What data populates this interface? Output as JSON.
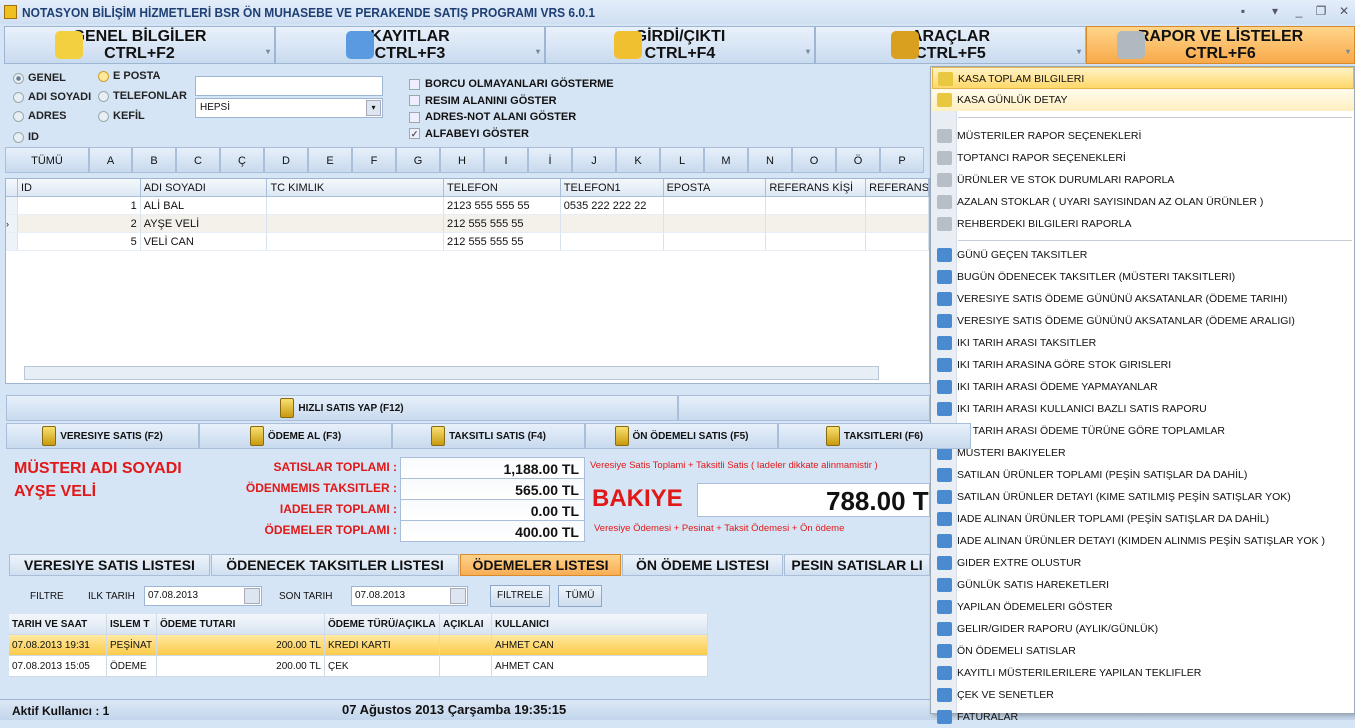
{
  "window": {
    "title": "NOTASYON BİLİŞİM HİZMETLERİ BSR ÖN MUHASEBE VE PERAKENDE SATIŞ PROGRAMI VRS 6.0.1",
    "controls": [
      "▪",
      "▾",
      "_",
      "❐",
      "✕"
    ]
  },
  "top_menu": [
    {
      "label": "GENEL BİLGİLER",
      "shortcut": "CTRL+F2",
      "icon": "monitor-icon",
      "color": "#f3d040"
    },
    {
      "label": "KAYITLAR",
      "shortcut": "CTRL+F3",
      "icon": "users-icon",
      "color": "#5a9ae0"
    },
    {
      "label": "GİRDİ/ÇIKTI",
      "shortcut": "CTRL+F4",
      "icon": "arrows-icon",
      "color": "#f0c030"
    },
    {
      "label": "ARAÇLAR",
      "shortcut": "CTRL+F5",
      "icon": "truck-icon",
      "color": "#d9a020"
    },
    {
      "label": "RAPOR VE LİSTELER",
      "shortcut": "CTRL+F6",
      "icon": "printer-icon",
      "color": "#b0b8c0"
    }
  ],
  "search": {
    "radios": [
      "GENEL",
      "ADI SOYADI",
      "ADRES",
      "ID",
      "E POSTA",
      "TELEFONLAR",
      "KEFİL"
    ],
    "text": "",
    "combo": "HEPSİ",
    "checks": [
      {
        "label": "BORCU OLMAYANLARI GÖSTERME",
        "checked": false
      },
      {
        "label": "RESIM ALANINI GÖSTER",
        "checked": false
      },
      {
        "label": "ADRES-NOT ALANI GÖSTER",
        "checked": false
      },
      {
        "label": "ALFABEYI GÖSTER",
        "checked": true
      }
    ]
  },
  "alphabet": [
    "TÜMÜ",
    "A",
    "B",
    "C",
    "Ç",
    "D",
    "E",
    "F",
    "G",
    "H",
    "I",
    "İ",
    "J",
    "K",
    "L",
    "M",
    "N",
    "O",
    "Ö",
    "P"
  ],
  "grid": {
    "columns": [
      "ID",
      "ADI SOYADI",
      "TC KIMLIK",
      "TELEFON",
      "TELEFON1",
      "EPOSTA",
      "REFERANS KİŞİ",
      "REFERANS"
    ],
    "rows": [
      [
        "1",
        "ALİ BAL",
        "",
        "2123 555 555 55",
        "0535 222 222 22",
        "",
        "",
        ""
      ],
      [
        "2",
        "AYŞE VELİ",
        "",
        "212 555 555 55",
        "",
        "",
        "",
        ""
      ],
      [
        "5",
        "VELİ CAN",
        "",
        "212 555 555 55",
        "",
        "",
        "",
        ""
      ]
    ]
  },
  "actions": {
    "quick": "HIZLI SATIS YAP  (F12)",
    "buttons": [
      "VERESIYE SATIS  (F2)",
      "ÖDEME AL (F3)",
      "TAKSITLI SATIS  (F4)",
      "ÖN ÖDEMELI SATIS   (F5)",
      "TAKSITLERI  (F6)"
    ]
  },
  "summary": {
    "customer_label": "MÜSTERI ADI SOYADI",
    "customer_name": "AYŞE VELİ",
    "rows": [
      {
        "label": "SATISLAR TOPLAMI :",
        "value": "1,188.00 TL"
      },
      {
        "label": "ÖDENMEMIS TAKSITLER :",
        "value": "565.00 TL"
      },
      {
        "label": "IADELER TOPLAMI :",
        "value": "0.00 TL"
      },
      {
        "label": "ÖDEMELER TOPLAMI :",
        "value": "400.00 TL"
      }
    ],
    "note1": "Veresiye Satis Toplami + Taksitli Satis ( Iadeler dikkate alinmamistir )",
    "note2": "Veresiye Ödemesi + Pesinat + Taksit Ödemesi + Ön ödeme",
    "balance_label": "BAKIYE",
    "balance_value": "788.00 TL"
  },
  "tabs": [
    "VERESIYE SATIS LISTESI",
    "ÖDENECEK TAKSITLER LISTESI",
    "ÖDEMELER LISTESI",
    "ÖN ÖDEME LISTESI",
    "PESIN SATISLAR LI"
  ],
  "filter": {
    "label": "FILTRE",
    "start_label": "ILK TARIH",
    "start": "07.08.2013",
    "end_label": "SON TARIH",
    "end": "07.08.2013",
    "filter_btn": "FILTRELE",
    "all_btn": "TÜMÜ"
  },
  "payments": {
    "columns": [
      "TARIH VE SAAT",
      "ISLEM T",
      "ÖDEME TUTARI",
      "ÖDEME TÜRÜ/AÇIKLA",
      "AÇIKLAI",
      "KULLANICI"
    ],
    "rows": [
      [
        "07.08.2013 19:31",
        "PEŞİNAT",
        "200.00 TL",
        "KREDI KARTI",
        "",
        "AHMET CAN"
      ],
      [
        "07.08.2013 15:05",
        "ÖDEME",
        "200.00 TL",
        "ÇEK",
        "",
        "AHMET CAN"
      ]
    ]
  },
  "status": {
    "user": "Aktif Kullanıcı :  1",
    "datetime": "07 Ağustos 2013 Çarşamba 19:35:15"
  },
  "report_menu": {
    "group1": [
      "KASA TOPLAM BILGILERI",
      "KASA GÜNLÜK DETAY"
    ],
    "group2": [
      "MÜSTERILER RAPOR SEÇENEKLERİ",
      "TOPTANCI RAPOR SEÇENEKLERİ",
      "ÜRÜNLER VE STOK DURUMLARI RAPORLA",
      "AZALAN STOKLAR ( UYARI SAYISINDAN AZ OLAN ÜRÜNLER )",
      "REHBERDEKI BILGILERI RAPORLA"
    ],
    "group3": [
      "GÜNÜ GEÇEN TAKSITLER",
      "BUGÜN ÖDENECEK TAKSITLER (MÜSTERI TAKSITLERI)",
      "VERESIYE SATIS ÖDEME GÜNÜNÜ AKSATANLAR (ÖDEME TARIHI)",
      "VERESIYE SATIS ÖDEME GÜNÜNÜ AKSATANLAR (ÖDEME ARALIGI)",
      "IKI TARIH ARASI TAKSITLER",
      "IKI TARIH ARASINA GÖRE STOK GIRISLERI",
      "IKI TARIH ARASI ÖDEME YAPMAYANLAR",
      "IKI TARIH ARASI KULLANICI BAZLI SATIS RAPORU",
      "IKI TARIH ARASI ÖDEME TÜRÜNE GÖRE TOPLAMLAR",
      "MÜSTERI BAKIYELER",
      "SATILAN ÜRÜNLER TOPLAMI (PEŞİN SATIŞLAR DA DAHİL)",
      "SATILAN ÜRÜNLER DETAYI (KIME SATILMIŞ PEŞİN SATIŞLAR YOK)",
      "IADE ALINAN ÜRÜNLER TOPLAMI (PEŞİN SATIŞLAR DA DAHİL)",
      "IADE ALINAN ÜRÜNLER DETAYI  (KIMDEN ALINMIS PEŞİN SATIŞLAR YOK )",
      "GIDER EXTRE OLUSTUR",
      "GÜNLÜK SATIS HAREKETLERI",
      "YAPILAN ÖDEMELERI GÖSTER",
      "GELIR/GIDER RAPORU (AYLIK/GÜNLÜK)",
      "ÖN ÖDEMELI SATISLAR",
      "KAYITLI MÜSTERILERILERE YAPILAN TEKLIFLER",
      "ÇEK VE SENETLER",
      "FATURALAR"
    ]
  }
}
